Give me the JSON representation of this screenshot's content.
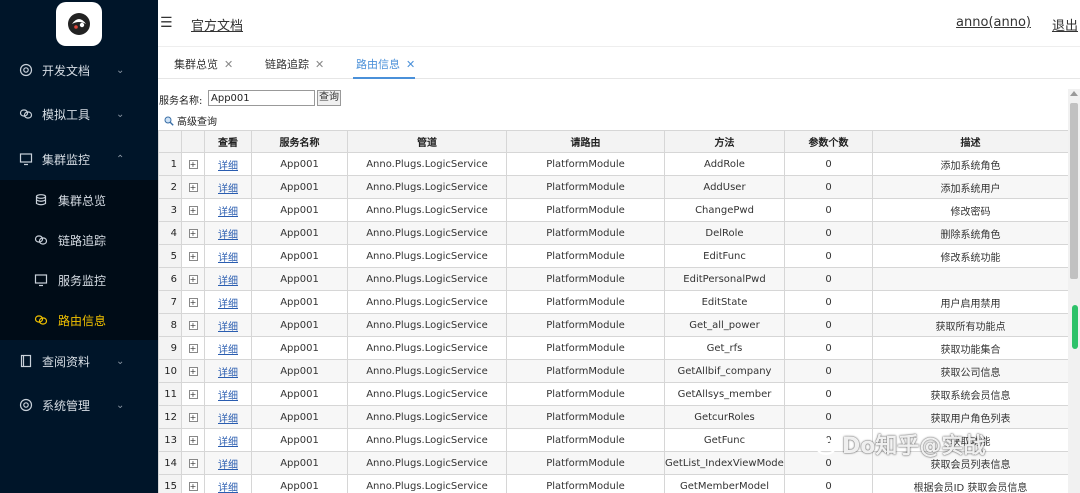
{
  "sidebar": {
    "items": [
      {
        "label": "开发文档",
        "icon": "gear-icon"
      },
      {
        "label": "模拟工具",
        "icon": "link-icon"
      },
      {
        "label": "集群监控",
        "icon": "monitor-icon"
      },
      {
        "label": "查阅资料",
        "icon": "book-icon"
      },
      {
        "label": "系统管理",
        "icon": "gear-icon"
      }
    ],
    "sub_items": [
      {
        "label": "集群总览",
        "icon": "database-icon"
      },
      {
        "label": "链路追踪",
        "icon": "link-icon"
      },
      {
        "label": "服务监控",
        "icon": "monitor-icon"
      },
      {
        "label": "路由信息",
        "icon": "link-icon",
        "active": true
      }
    ]
  },
  "header": {
    "doc_link": "官方文档",
    "user": "anno(anno)",
    "logout": "退出"
  },
  "tabs": [
    {
      "label": "集群总览"
    },
    {
      "label": "链路追踪"
    },
    {
      "label": "路由信息",
      "active": true
    }
  ],
  "search": {
    "label": "服务名称:",
    "value": "App001",
    "button": "查询",
    "advanced": "高级查询"
  },
  "table": {
    "columns": [
      "",
      "",
      "查看",
      "服务名称",
      "管道",
      "请路由",
      "方法",
      "参数个数",
      "描述"
    ],
    "detail_label": "详细",
    "rows": [
      {
        "n": "1",
        "service": "App001",
        "pipe": "Anno.Plugs.LogicService",
        "route": "PlatformModule",
        "method": "AddRole",
        "params": "0",
        "desc": "添加系统角色"
      },
      {
        "n": "2",
        "service": "App001",
        "pipe": "Anno.Plugs.LogicService",
        "route": "PlatformModule",
        "method": "AddUser",
        "params": "0",
        "desc": "添加系统用户"
      },
      {
        "n": "3",
        "service": "App001",
        "pipe": "Anno.Plugs.LogicService",
        "route": "PlatformModule",
        "method": "ChangePwd",
        "params": "0",
        "desc": "修改密码"
      },
      {
        "n": "4",
        "service": "App001",
        "pipe": "Anno.Plugs.LogicService",
        "route": "PlatformModule",
        "method": "DelRole",
        "params": "0",
        "desc": "删除系统角色"
      },
      {
        "n": "5",
        "service": "App001",
        "pipe": "Anno.Plugs.LogicService",
        "route": "PlatformModule",
        "method": "EditFunc",
        "params": "0",
        "desc": "修改系统功能"
      },
      {
        "n": "6",
        "service": "App001",
        "pipe": "Anno.Plugs.LogicService",
        "route": "PlatformModule",
        "method": "EditPersonalPwd",
        "params": "0",
        "desc": ""
      },
      {
        "n": "7",
        "service": "App001",
        "pipe": "Anno.Plugs.LogicService",
        "route": "PlatformModule",
        "method": "EditState",
        "params": "0",
        "desc": "用户启用禁用"
      },
      {
        "n": "8",
        "service": "App001",
        "pipe": "Anno.Plugs.LogicService",
        "route": "PlatformModule",
        "method": "Get_all_power",
        "params": "0",
        "desc": "获取所有功能点"
      },
      {
        "n": "9",
        "service": "App001",
        "pipe": "Anno.Plugs.LogicService",
        "route": "PlatformModule",
        "method": "Get_rfs",
        "params": "0",
        "desc": "获取功能集合"
      },
      {
        "n": "10",
        "service": "App001",
        "pipe": "Anno.Plugs.LogicService",
        "route": "PlatformModule",
        "method": "GetAllbif_company",
        "params": "0",
        "desc": "获取公司信息"
      },
      {
        "n": "11",
        "service": "App001",
        "pipe": "Anno.Plugs.LogicService",
        "route": "PlatformModule",
        "method": "GetAllsys_member",
        "params": "0",
        "desc": "获取系统会员信息"
      },
      {
        "n": "12",
        "service": "App001",
        "pipe": "Anno.Plugs.LogicService",
        "route": "PlatformModule",
        "method": "GetcurRoles",
        "params": "0",
        "desc": "获取用户角色列表"
      },
      {
        "n": "13",
        "service": "App001",
        "pipe": "Anno.Plugs.LogicService",
        "route": "PlatformModule",
        "method": "GetFunc",
        "params": "0",
        "desc": "获取功能"
      },
      {
        "n": "14",
        "service": "App001",
        "pipe": "Anno.Plugs.LogicService",
        "route": "PlatformModule",
        "method": "GetList_IndexViewModel",
        "params": "0",
        "desc": "获取会员列表信息"
      },
      {
        "n": "15",
        "service": "App001",
        "pipe": "Anno.Plugs.LogicService",
        "route": "PlatformModule",
        "method": "GetMemberModel",
        "params": "0",
        "desc": "根据会员ID 获取会员信息"
      }
    ]
  },
  "watermark": "Do知乎@实战",
  "colors": {
    "sidebar_bg": "#001529",
    "active_menu": "#f2c200",
    "tab_active": "#4a90d9",
    "link": "#2a5db0"
  }
}
